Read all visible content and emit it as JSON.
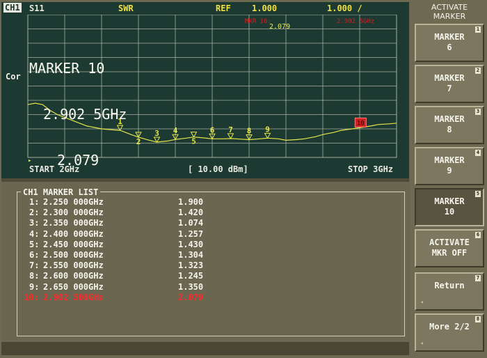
{
  "header": {
    "channel": "CH1",
    "parameter": "S11",
    "format": "SWR",
    "ref_label": "REF",
    "ref_value": "1.000",
    "scale_value": "1.000 /",
    "mkr_label": "MKR 10:",
    "mkr_freq": "2.902 5GHz",
    "mkr_value": "2.079"
  },
  "display": {
    "cor": "Cor",
    "marker_big": [
      "MARKER 10",
      "2.902 5GHz",
      "2.079"
    ],
    "start": "START 2GHz",
    "power": "[ 10.00 dBm]",
    "stop": "STOP 3GHz"
  },
  "chart_data": {
    "type": "line",
    "title": "",
    "xlabel": "",
    "ylabel": "",
    "xlim": [
      2.0,
      3.0
    ],
    "ylim": [
      0.0,
      10.0
    ],
    "grid": true,
    "series": [
      {
        "x": [
          2.0,
          2.02,
          2.04,
          2.06,
          2.08,
          2.1,
          2.12,
          2.14,
          2.16,
          2.18,
          2.2,
          2.22,
          2.25,
          2.28,
          2.3,
          2.33,
          2.35,
          2.38,
          2.4,
          2.43,
          2.45,
          2.48,
          2.5,
          2.53,
          2.55,
          2.58,
          2.6,
          2.63,
          2.65,
          2.68,
          2.7,
          2.73,
          2.75,
          2.78,
          2.8,
          2.83,
          2.85,
          2.88,
          2.9,
          2.93,
          2.95,
          2.98,
          3.0
        ],
        "y": [
          3.7,
          3.8,
          3.7,
          3.3,
          3.0,
          2.8,
          2.6,
          2.4,
          2.2,
          2.1,
          2.0,
          1.95,
          1.9,
          1.6,
          1.42,
          1.2,
          1.074,
          1.15,
          1.257,
          1.35,
          1.43,
          1.36,
          1.304,
          1.3,
          1.323,
          1.28,
          1.245,
          1.3,
          1.35,
          1.3,
          1.2,
          1.25,
          1.3,
          1.45,
          1.6,
          1.75,
          1.9,
          2.0,
          2.079,
          2.2,
          2.3,
          2.35,
          2.4
        ]
      }
    ],
    "markers": [
      {
        "id": "1",
        "x": 2.25,
        "y": 1.9
      },
      {
        "id": "2",
        "x": 2.3,
        "y": 1.42
      },
      {
        "id": "3",
        "x": 2.35,
        "y": 1.074
      },
      {
        "id": "4",
        "x": 2.4,
        "y": 1.257
      },
      {
        "id": "5",
        "x": 2.45,
        "y": 1.43
      },
      {
        "id": "6",
        "x": 2.5,
        "y": 1.304
      },
      {
        "id": "7",
        "x": 2.55,
        "y": 1.323
      },
      {
        "id": "8",
        "x": 2.6,
        "y": 1.245
      },
      {
        "id": "9",
        "x": 2.65,
        "y": 1.35
      },
      {
        "id": "10",
        "x": 2.9025,
        "y": 2.079
      }
    ]
  },
  "marker_list": {
    "title": "CH1 MARKER LIST",
    "rows": [
      {
        "num": "1:",
        "freq": "2.250 000GHz",
        "value": "1.900"
      },
      {
        "num": "2:",
        "freq": "2.300 000GHz",
        "value": "1.420"
      },
      {
        "num": "3:",
        "freq": "2.350 000GHz",
        "value": "1.074"
      },
      {
        "num": "4:",
        "freq": "2.400 000GHz",
        "value": "1.257"
      },
      {
        "num": "5:",
        "freq": "2.450 000GHz",
        "value": "1.430"
      },
      {
        "num": "6:",
        "freq": "2.500 000GHz",
        "value": "1.304"
      },
      {
        "num": "7:",
        "freq": "2.550 000GHz",
        "value": "1.323"
      },
      {
        "num": "8:",
        "freq": "2.600 000GHz",
        "value": "1.245"
      },
      {
        "num": "9:",
        "freq": "2.650 000GHz",
        "value": "1.350"
      },
      {
        "num": "10:",
        "freq": "2.902 500GHz",
        "value": "2.079"
      }
    ]
  },
  "softkeys": {
    "title": "ACTIVATE\nMARKER",
    "keys": [
      {
        "label": "MARKER\n6",
        "num": "1"
      },
      {
        "label": "MARKER\n7",
        "num": "2"
      },
      {
        "label": "MARKER\n8",
        "num": "3"
      },
      {
        "label": "MARKER\n9",
        "num": "4"
      },
      {
        "label": "MARKER\n10",
        "num": "5"
      },
      {
        "label": "ACTIVATE\nMKR OFF",
        "num": "6"
      },
      {
        "label": "Return",
        "num": "7"
      },
      {
        "label": "More 2/2",
        "num": "8"
      }
    ]
  },
  "colors": {
    "trace": "#e6e64a",
    "marker": "#e6e64a",
    "active_marker": "#d02020",
    "grid": "#aab0a0"
  }
}
